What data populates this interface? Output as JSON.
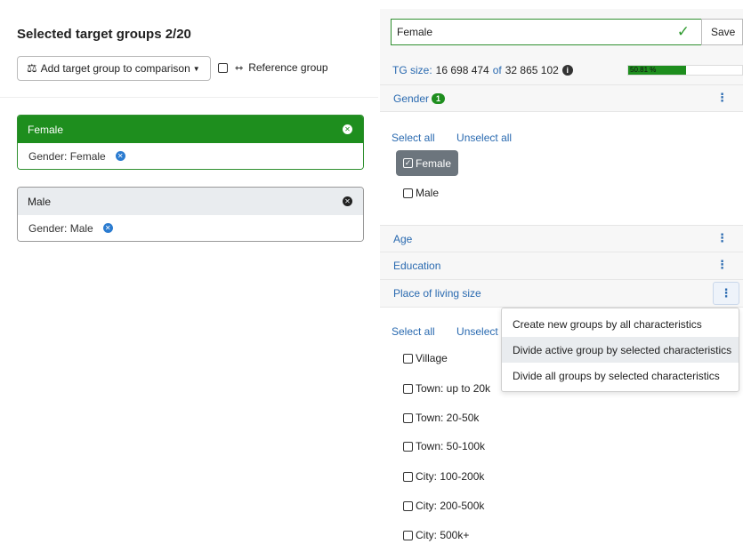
{
  "left": {
    "title": "Selected target groups 2/20",
    "add_button": {
      "icon": "⚖",
      "label": "Add target group to comparison"
    },
    "reference": {
      "icon": "⇿",
      "label": "Reference group"
    },
    "groups": [
      {
        "name": "Female",
        "filter": "Gender: Female",
        "active": true
      },
      {
        "name": "Male",
        "filter": "Gender: Male",
        "active": false
      }
    ]
  },
  "right": {
    "group_name_value": "Female",
    "save_label": "Save",
    "tg_size": {
      "prefix": "TG size:",
      "current": "16 698 474",
      "of": "of",
      "total": "32 865 102",
      "percent_label": "50.81 %",
      "percent": 50.81
    },
    "sections": {
      "gender": {
        "label": "Gender",
        "badge": "1"
      },
      "age": {
        "label": "Age"
      },
      "education": {
        "label": "Education"
      },
      "place": {
        "label": "Place of living size"
      }
    },
    "select_all": "Select all",
    "unselect_all": "Unselect all",
    "unselect_partial": "Unselect a",
    "gender_options": [
      "Female",
      "Male"
    ],
    "place_options": [
      "Village",
      "Town: up to 20k",
      "Town: 20-50k",
      "Town: 50-100k",
      "City: 100-200k",
      "City: 200-500k",
      "City: 500k+"
    ]
  },
  "menu": {
    "items": [
      "Create new groups by all characteristics",
      "Divide active group by selected characteristics",
      "Divide all groups by selected characteristics"
    ]
  },
  "colors": {
    "accent": "#1e8e1e",
    "link": "#2a6ab0",
    "chip": "#6c757d"
  }
}
